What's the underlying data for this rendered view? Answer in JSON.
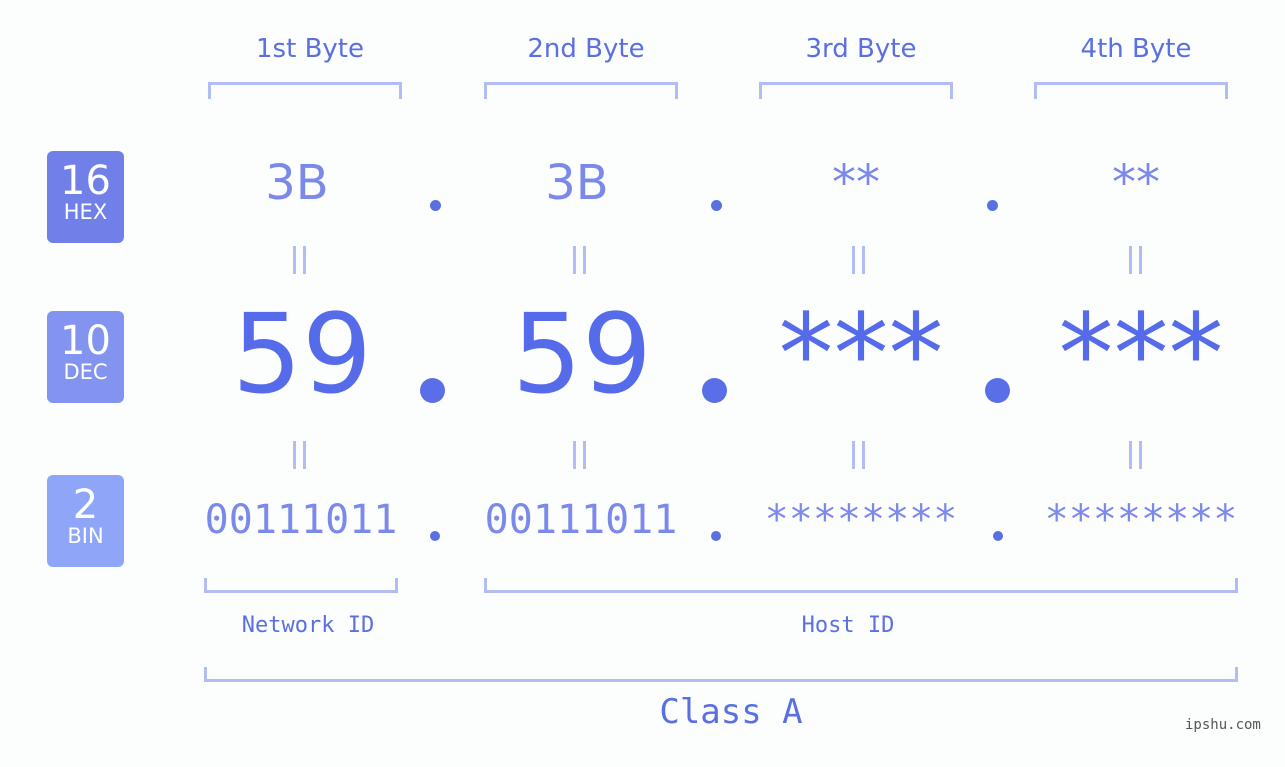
{
  "headers": [
    "1st Byte",
    "2nd Byte",
    "3rd Byte",
    "4th Byte"
  ],
  "badges": [
    {
      "num": "16",
      "label": "HEX",
      "color": "#7080e8"
    },
    {
      "num": "10",
      "label": "DEC",
      "color": "#8394f0"
    },
    {
      "num": "2",
      "label": "BIN",
      "color": "#8fa6f8"
    }
  ],
  "hex": [
    "3B",
    "3B",
    "**",
    "**"
  ],
  "dec": [
    "59",
    "59",
    "***",
    "***"
  ],
  "bin": [
    "00111011",
    "00111011",
    "********",
    "********"
  ],
  "network_label": "Network ID",
  "host_label": "Host ID",
  "class_label": "Class A",
  "watermark": "ipshu.com",
  "colors": {
    "accent": "#5a6fe0",
    "bracket": "#b3bdf5",
    "badge_hex": "#7080e8",
    "badge_dec": "#8394f0",
    "badge_bin": "#8fa6f8"
  }
}
